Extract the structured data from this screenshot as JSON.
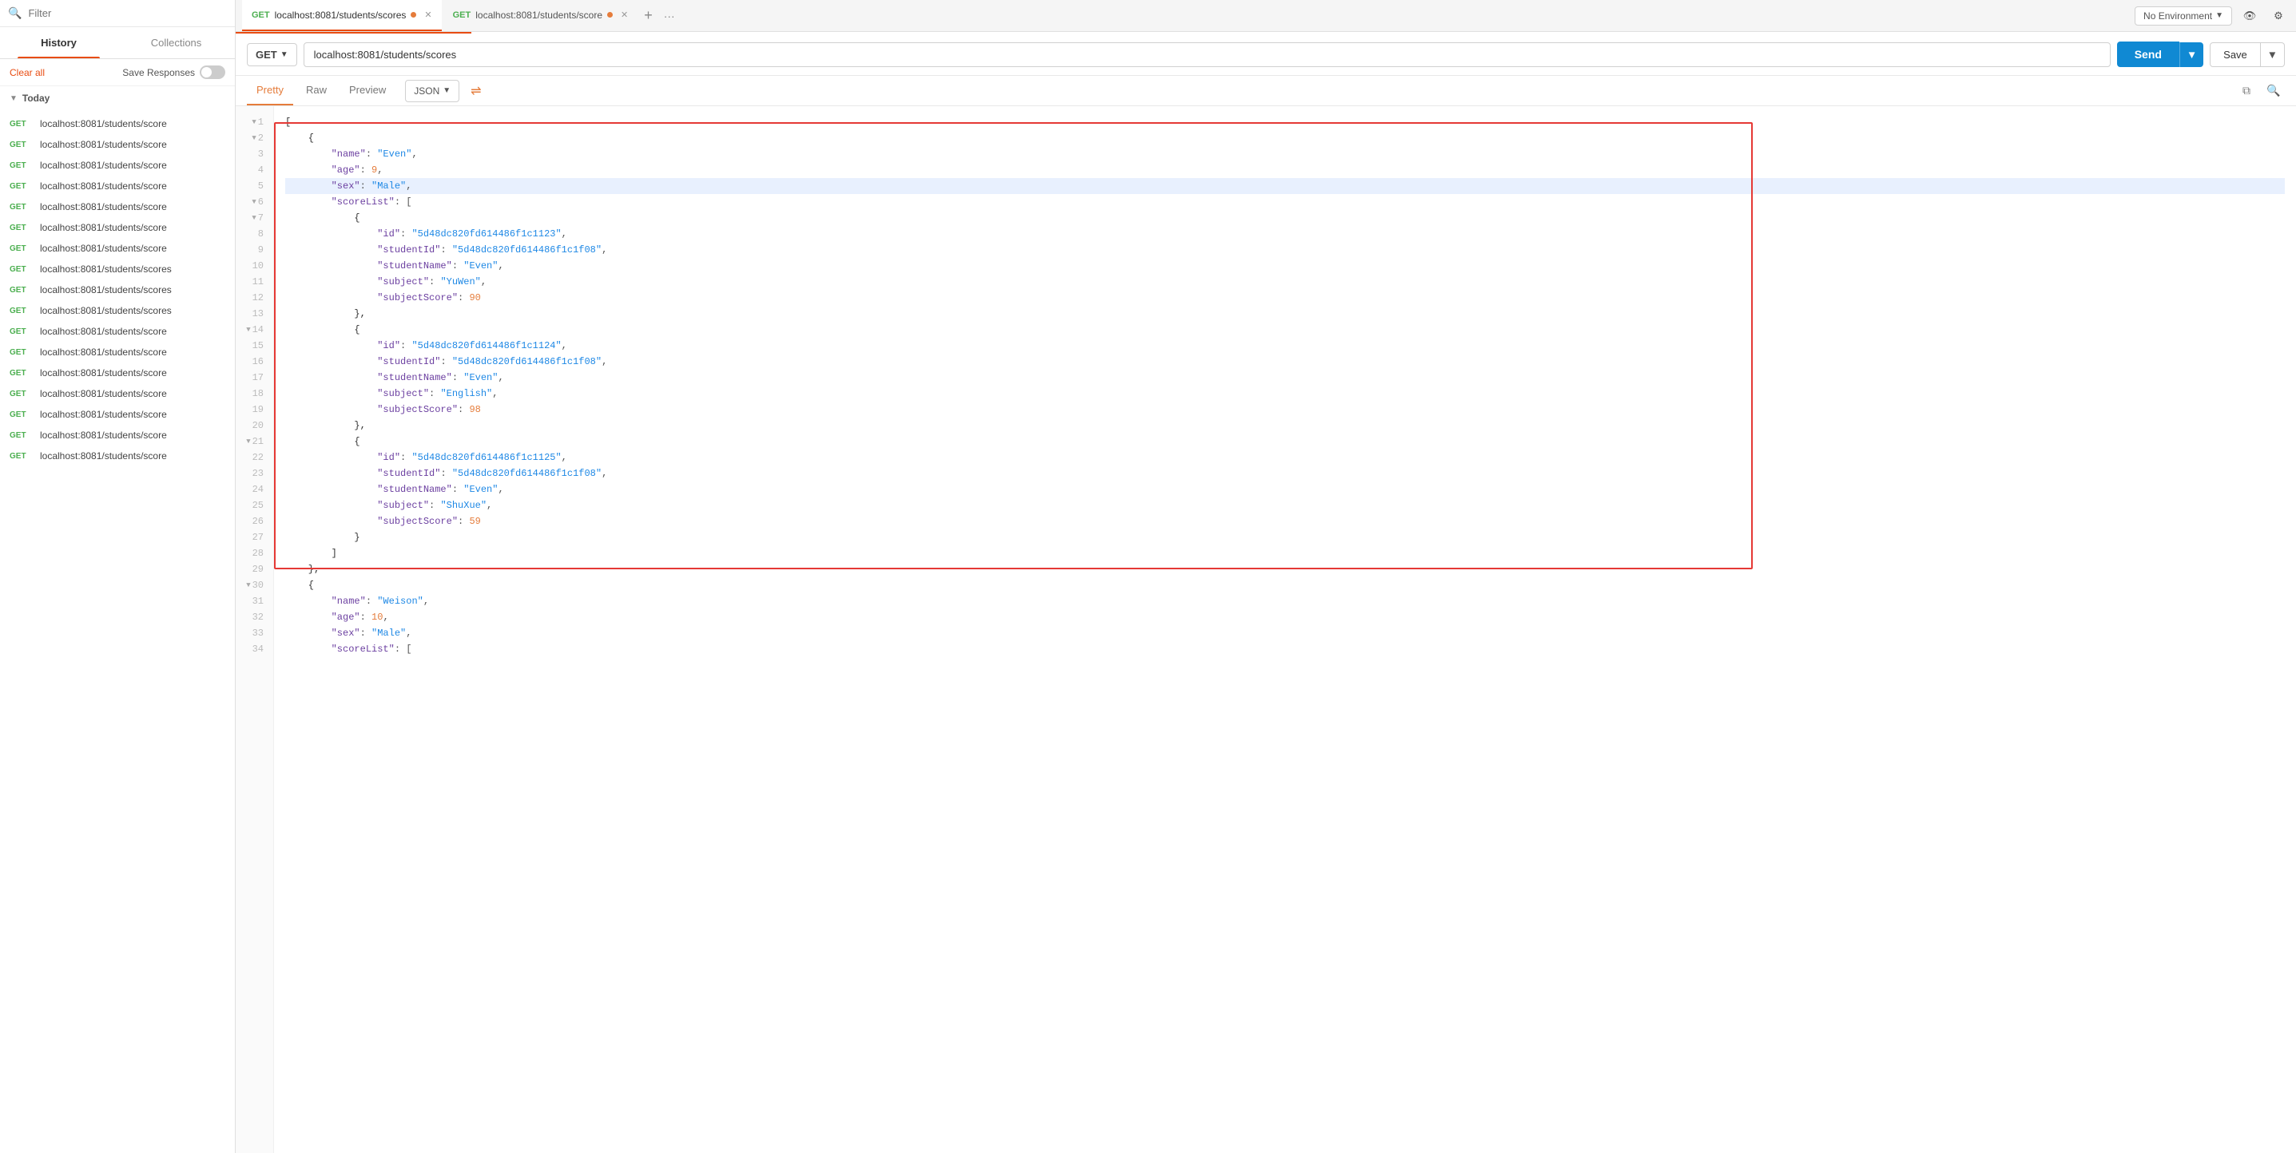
{
  "sidebar": {
    "search_placeholder": "Filter",
    "tab_history": "History",
    "tab_collections": "Collections",
    "clear_all": "Clear all",
    "save_responses": "Save Responses",
    "toggle_on": false,
    "section_today": "Today",
    "history_items": [
      {
        "method": "GET",
        "url": "localhost:8081/students/score"
      },
      {
        "method": "GET",
        "url": "localhost:8081/students/score"
      },
      {
        "method": "GET",
        "url": "localhost:8081/students/score"
      },
      {
        "method": "GET",
        "url": "localhost:8081/students/score"
      },
      {
        "method": "GET",
        "url": "localhost:8081/students/score"
      },
      {
        "method": "GET",
        "url": "localhost:8081/students/score"
      },
      {
        "method": "GET",
        "url": "localhost:8081/students/score"
      },
      {
        "method": "GET",
        "url": "localhost:8081/students/scores"
      },
      {
        "method": "GET",
        "url": "localhost:8081/students/scores"
      },
      {
        "method": "GET",
        "url": "localhost:8081/students/scores"
      },
      {
        "method": "GET",
        "url": "localhost:8081/students/score"
      },
      {
        "method": "GET",
        "url": "localhost:8081/students/score"
      },
      {
        "method": "GET",
        "url": "localhost:8081/students/score"
      },
      {
        "method": "GET",
        "url": "localhost:8081/students/score"
      },
      {
        "method": "GET",
        "url": "localhost:8081/students/score"
      },
      {
        "method": "GET",
        "url": "localhost:8081/students/score"
      },
      {
        "method": "GET",
        "url": "localhost:8081/students/score"
      }
    ]
  },
  "header": {
    "tab1_method": "GET",
    "tab1_url": "localhost:8081/students/scores",
    "tab2_method": "GET",
    "tab2_url": "localhost:8081/students/score",
    "env_label": "No Environment",
    "send_label": "Send",
    "save_label": "Save"
  },
  "request_bar": {
    "method": "GET",
    "url": "localhost:8081/students/scores"
  },
  "response_tabs": {
    "pretty": "Pretty",
    "raw": "Raw",
    "preview": "Preview",
    "json_label": "JSON"
  },
  "code_lines": [
    {
      "num": 1,
      "has_expand": true,
      "content": "[",
      "type": "bracket"
    },
    {
      "num": 2,
      "has_expand": true,
      "content": "    {",
      "type": "bracket"
    },
    {
      "num": 3,
      "has_expand": false,
      "content": "        \"name\": \"Even\",",
      "type": "kv_str"
    },
    {
      "num": 4,
      "has_expand": false,
      "content": "        \"age\": 9,",
      "type": "kv_num"
    },
    {
      "num": 5,
      "has_expand": false,
      "content": "        \"sex\": \"Male\",",
      "type": "kv_str",
      "highlighted": true
    },
    {
      "num": 6,
      "has_expand": true,
      "content": "        \"scoreList\": [",
      "type": "kv_arr"
    },
    {
      "num": 7,
      "has_expand": true,
      "content": "            {",
      "type": "bracket"
    },
    {
      "num": 8,
      "has_expand": false,
      "content": "                \"id\": \"5d48dc820fd614486f1c1123\",",
      "type": "kv_str"
    },
    {
      "num": 9,
      "has_expand": false,
      "content": "                \"studentId\": \"5d48dc820fd614486f1c1f08\",",
      "type": "kv_str"
    },
    {
      "num": 10,
      "has_expand": false,
      "content": "                \"studentName\": \"Even\",",
      "type": "kv_str"
    },
    {
      "num": 11,
      "has_expand": false,
      "content": "                \"subject\": \"YuWen\",",
      "type": "kv_str"
    },
    {
      "num": 12,
      "has_expand": false,
      "content": "                \"subjectScore\": 90",
      "type": "kv_num"
    },
    {
      "num": 13,
      "has_expand": false,
      "content": "            },",
      "type": "bracket"
    },
    {
      "num": 14,
      "has_expand": true,
      "content": "            {",
      "type": "bracket"
    },
    {
      "num": 15,
      "has_expand": false,
      "content": "                \"id\": \"5d48dc820fd614486f1c1124\",",
      "type": "kv_str"
    },
    {
      "num": 16,
      "has_expand": false,
      "content": "                \"studentId\": \"5d48dc820fd614486f1c1f08\",",
      "type": "kv_str"
    },
    {
      "num": 17,
      "has_expand": false,
      "content": "                \"studentName\": \"Even\",",
      "type": "kv_str"
    },
    {
      "num": 18,
      "has_expand": false,
      "content": "                \"subject\": \"English\",",
      "type": "kv_str"
    },
    {
      "num": 19,
      "has_expand": false,
      "content": "                \"subjectScore\": 98",
      "type": "kv_num"
    },
    {
      "num": 20,
      "has_expand": false,
      "content": "            },",
      "type": "bracket"
    },
    {
      "num": 21,
      "has_expand": true,
      "content": "            {",
      "type": "bracket"
    },
    {
      "num": 22,
      "has_expand": false,
      "content": "                \"id\": \"5d48dc820fd614486f1c1125\",",
      "type": "kv_str"
    },
    {
      "num": 23,
      "has_expand": false,
      "content": "                \"studentId\": \"5d48dc820fd614486f1c1f08\",",
      "type": "kv_str"
    },
    {
      "num": 24,
      "has_expand": false,
      "content": "                \"studentName\": \"Even\",",
      "type": "kv_str"
    },
    {
      "num": 25,
      "has_expand": false,
      "content": "                \"subject\": \"ShuXue\",",
      "type": "kv_str"
    },
    {
      "num": 26,
      "has_expand": false,
      "content": "                \"subjectScore\": 59",
      "type": "kv_num"
    },
    {
      "num": 27,
      "has_expand": false,
      "content": "            }",
      "type": "bracket"
    },
    {
      "num": 28,
      "has_expand": false,
      "content": "        ]",
      "type": "bracket"
    },
    {
      "num": 29,
      "has_expand": false,
      "content": "    },",
      "type": "bracket"
    },
    {
      "num": 30,
      "has_expand": true,
      "content": "    {",
      "type": "bracket"
    },
    {
      "num": 31,
      "has_expand": false,
      "content": "        \"name\": \"Weison\",",
      "type": "kv_str"
    },
    {
      "num": 32,
      "has_expand": false,
      "content": "        \"age\": 10,",
      "type": "kv_num"
    },
    {
      "num": 33,
      "has_expand": false,
      "content": "        \"sex\": \"Male\",",
      "type": "kv_str"
    },
    {
      "num": 34,
      "has_expand": false,
      "content": "        \"scoreList\": [",
      "type": "kv_arr"
    }
  ]
}
